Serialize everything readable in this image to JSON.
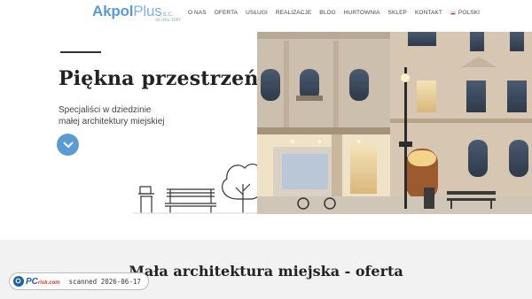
{
  "header": {
    "logo_main": "Akpol",
    "logo_plus": "Plus",
    "logo_sc": "s.c.",
    "logo_sub": "od roku 1987",
    "nav": [
      {
        "label": "O NAS"
      },
      {
        "label": "OFERTA"
      },
      {
        "label": "USŁUGI"
      },
      {
        "label": "REALIZACJE"
      },
      {
        "label": "BLOG"
      },
      {
        "label": "HURTOWNIA"
      },
      {
        "label": "SKLEP"
      },
      {
        "label": "KONTAKT"
      }
    ],
    "language": "POLSKI"
  },
  "hero": {
    "title": "Piękna przestrzeń",
    "subtitle_line1": "Specjaliści w dziedzinie",
    "subtitle_line2": "małej architektury miejskiej"
  },
  "section": {
    "title": "Mała architektura miejska - oferta"
  },
  "watermark": {
    "logo_pc": "PC",
    "logo_risk": "risk.com",
    "text": "scanned 2026-06-17"
  },
  "colors": {
    "accent": "#5b9bd5",
    "band": "#f2f2f2"
  }
}
